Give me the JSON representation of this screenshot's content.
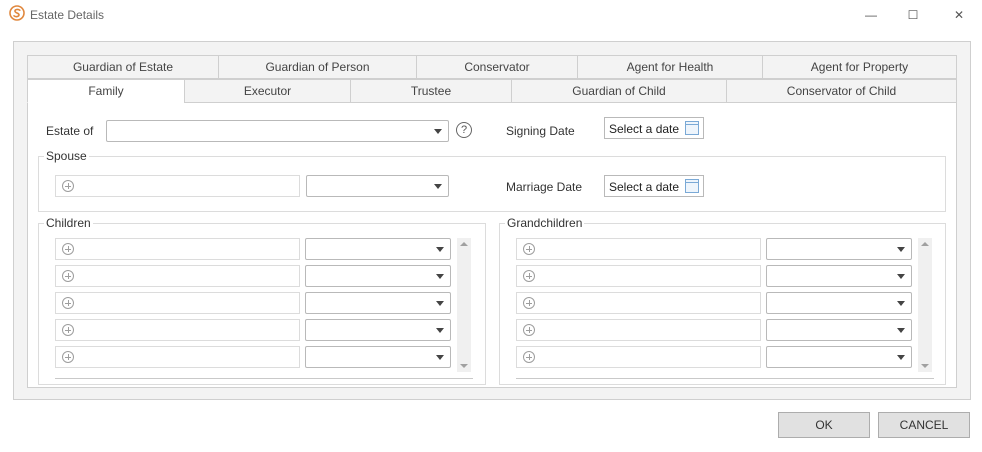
{
  "window": {
    "title": "Estate Details",
    "minimize": "—",
    "maximize": "☐",
    "close": "✕"
  },
  "tabs_row1": [
    "Guardian of Estate",
    "Guardian of Person",
    "Conservator",
    "Agent for Health",
    "Agent for Property"
  ],
  "tabs_row2": [
    "Family",
    "Executor",
    "Trustee",
    "Guardian of Child",
    "Conservator of Child"
  ],
  "form": {
    "estate_of_label": "Estate of",
    "estate_of_value": "",
    "help": "?",
    "signing_date_label": "Signing Date",
    "signing_date_placeholder": "Select a date",
    "spouse_label": "Spouse",
    "marriage_date_label": "Marriage Date",
    "marriage_date_placeholder": "Select a date"
  },
  "children": {
    "label": "Children",
    "rows": 5
  },
  "grandchildren": {
    "label": "Grandchildren",
    "rows": 5
  },
  "buttons": {
    "ok": "OK",
    "cancel": "CANCEL"
  },
  "colors": {
    "frame_border": "#cfcfcf",
    "accent": "#7aa9d6",
    "icon_orange": "#e0873d"
  }
}
